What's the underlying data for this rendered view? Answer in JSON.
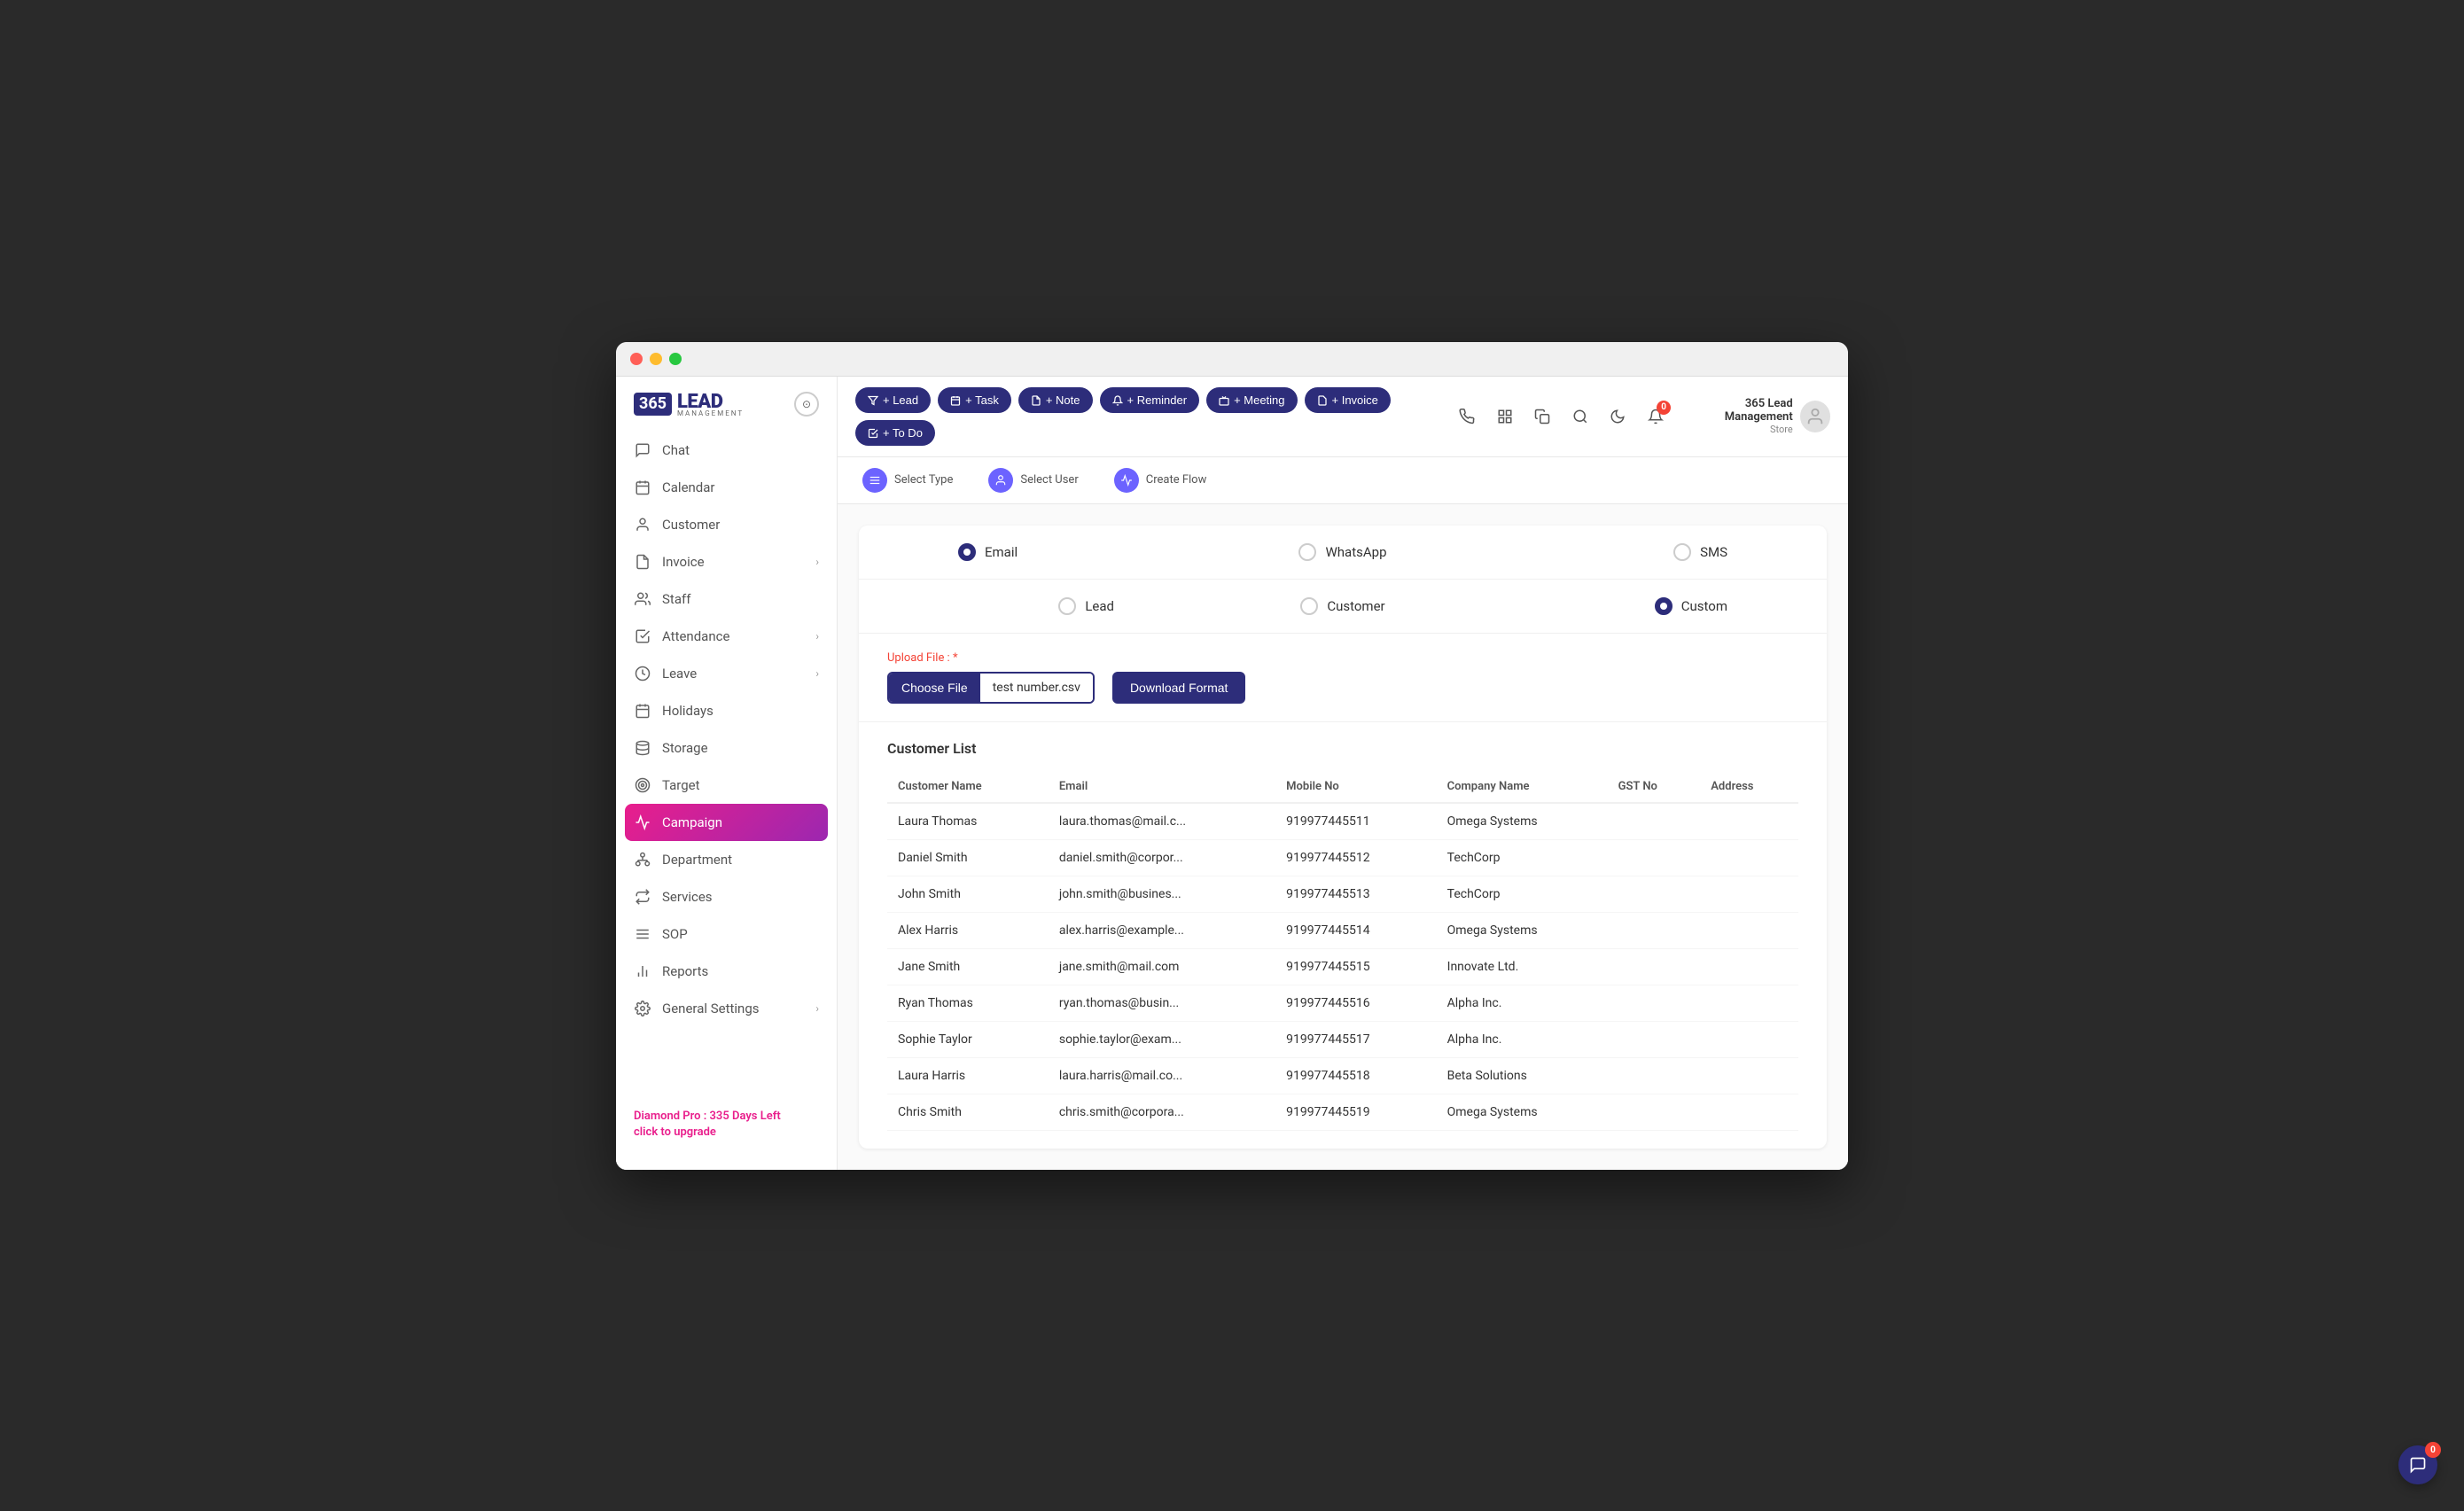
{
  "window": {
    "title": "365 Lead Management"
  },
  "logo": {
    "number": "365",
    "name": "LEAD",
    "tagline": "MANAGEMENT"
  },
  "sidebar": {
    "items": [
      {
        "id": "chat",
        "label": "Chat",
        "icon": "chat"
      },
      {
        "id": "calendar",
        "label": "Calendar",
        "icon": "calendar"
      },
      {
        "id": "customer",
        "label": "Customer",
        "icon": "customer"
      },
      {
        "id": "invoice",
        "label": "Invoice",
        "icon": "invoice",
        "arrow": true
      },
      {
        "id": "staff",
        "label": "Staff",
        "icon": "staff"
      },
      {
        "id": "attendance",
        "label": "Attendance",
        "icon": "attendance",
        "arrow": true
      },
      {
        "id": "leave",
        "label": "Leave",
        "icon": "leave",
        "arrow": true
      },
      {
        "id": "holidays",
        "label": "Holidays",
        "icon": "holidays"
      },
      {
        "id": "storage",
        "label": "Storage",
        "icon": "storage"
      },
      {
        "id": "target",
        "label": "Target",
        "icon": "target"
      },
      {
        "id": "campaign",
        "label": "Campaign",
        "icon": "campaign",
        "active": true
      },
      {
        "id": "department",
        "label": "Department",
        "icon": "department"
      },
      {
        "id": "services",
        "label": "Services",
        "icon": "services"
      },
      {
        "id": "sop",
        "label": "SOP",
        "icon": "sop"
      },
      {
        "id": "reports",
        "label": "Reports",
        "icon": "reports"
      },
      {
        "id": "general-settings",
        "label": "General Settings",
        "icon": "settings",
        "arrow": true
      }
    ],
    "upgrade": {
      "line1": "Diamond Pro : 335 Days Left",
      "line2": "click to upgrade"
    }
  },
  "toolbar": {
    "buttons": [
      {
        "id": "lead",
        "label": "+ Lead",
        "icon": "filter"
      },
      {
        "id": "task",
        "label": "+ Task",
        "icon": "calendar"
      },
      {
        "id": "note",
        "label": "+ Note",
        "icon": "note"
      },
      {
        "id": "reminder",
        "label": "+ Reminder",
        "icon": "bell"
      },
      {
        "id": "meeting",
        "label": "+ Meeting",
        "icon": "meeting"
      },
      {
        "id": "invoice",
        "label": "+ Invoice",
        "icon": "invoice"
      },
      {
        "id": "todo",
        "label": "+ To Do",
        "icon": "todo"
      }
    ],
    "icons": [
      "phone",
      "grid",
      "copy",
      "search",
      "moon",
      "bell"
    ],
    "notification_count": "0",
    "user": {
      "name": "365 Lead Management",
      "store": "Store"
    }
  },
  "sub_toolbar": {
    "items": [
      {
        "id": "select-type",
        "label": "Select Type"
      },
      {
        "id": "select-user",
        "label": "Select User"
      },
      {
        "id": "create-flow",
        "label": "Create Flow"
      }
    ]
  },
  "channel_options": [
    {
      "id": "email",
      "label": "Email",
      "checked": true
    },
    {
      "id": "whatsapp",
      "label": "WhatsApp",
      "checked": false
    },
    {
      "id": "sms",
      "label": "SMS",
      "checked": false
    }
  ],
  "target_options": [
    {
      "id": "lead",
      "label": "Lead",
      "checked": false
    },
    {
      "id": "customer",
      "label": "Customer",
      "checked": false
    },
    {
      "id": "custom",
      "label": "Custom",
      "checked": true
    }
  ],
  "upload": {
    "label": "Upload File :",
    "required": "*",
    "choose_btn": "Choose File",
    "file_name": "test number.csv",
    "download_btn": "Download Format"
  },
  "customer_list": {
    "title": "Customer List",
    "columns": [
      "Customer Name",
      "Email",
      "Mobile No",
      "Company Name",
      "GST No",
      "Address"
    ],
    "rows": [
      {
        "name": "Laura Thomas",
        "email": "laura.thomas@mail.c...",
        "mobile": "919977445511",
        "company": "Omega Systems",
        "gst": "",
        "address": ""
      },
      {
        "name": "Daniel Smith",
        "email": "daniel.smith@corpor...",
        "mobile": "919977445512",
        "company": "TechCorp",
        "gst": "",
        "address": ""
      },
      {
        "name": "John Smith",
        "email": "john.smith@busines...",
        "mobile": "919977445513",
        "company": "TechCorp",
        "gst": "",
        "address": ""
      },
      {
        "name": "Alex Harris",
        "email": "alex.harris@example...",
        "mobile": "919977445514",
        "company": "Omega Systems",
        "gst": "",
        "address": ""
      },
      {
        "name": "Jane Smith",
        "email": "jane.smith@mail.com",
        "mobile": "919977445515",
        "company": "Innovate Ltd.",
        "gst": "",
        "address": ""
      },
      {
        "name": "Ryan Thomas",
        "email": "ryan.thomas@busin...",
        "mobile": "919977445516",
        "company": "Alpha Inc.",
        "gst": "",
        "address": ""
      },
      {
        "name": "Sophie Taylor",
        "email": "sophie.taylor@exam...",
        "mobile": "919977445517",
        "company": "Alpha Inc.",
        "gst": "",
        "address": ""
      },
      {
        "name": "Laura Harris",
        "email": "laura.harris@mail.co...",
        "mobile": "919977445518",
        "company": "Beta Solutions",
        "gst": "",
        "address": ""
      },
      {
        "name": "Chris Smith",
        "email": "chris.smith@corpora...",
        "mobile": "919977445519",
        "company": "Omega Systems",
        "gst": "",
        "address": ""
      }
    ]
  },
  "floating_chat": {
    "badge": "0"
  }
}
